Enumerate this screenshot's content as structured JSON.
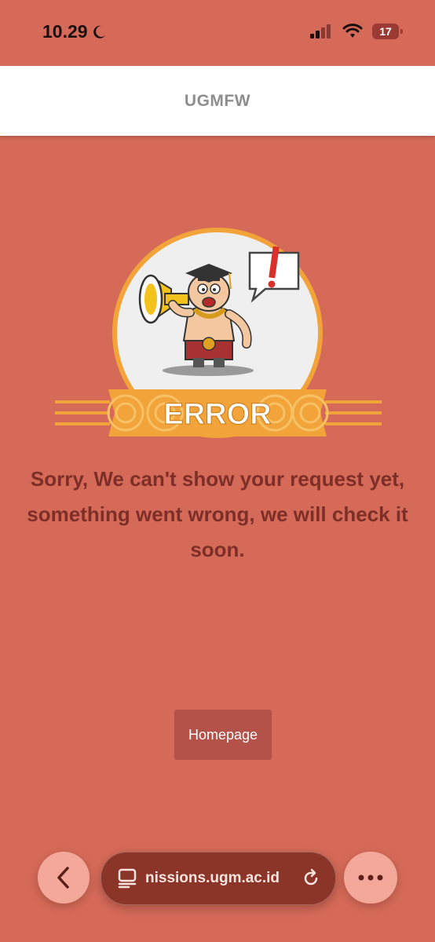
{
  "status": {
    "time": "10.29",
    "battery": "17"
  },
  "header": {
    "title": "UGMFW"
  },
  "illustration": {
    "badge_text": "ERROR"
  },
  "message": {
    "text": "Sorry, We can't show your request yet, something went wrong, we will check it soon."
  },
  "actions": {
    "homepage_label": "Homepage"
  },
  "browser": {
    "url": "nissions.ugm.ac.id"
  },
  "colors": {
    "background": "#d66a58",
    "message": "#7d2f27",
    "button": "#b45148",
    "url_bar": "#8b3428"
  }
}
